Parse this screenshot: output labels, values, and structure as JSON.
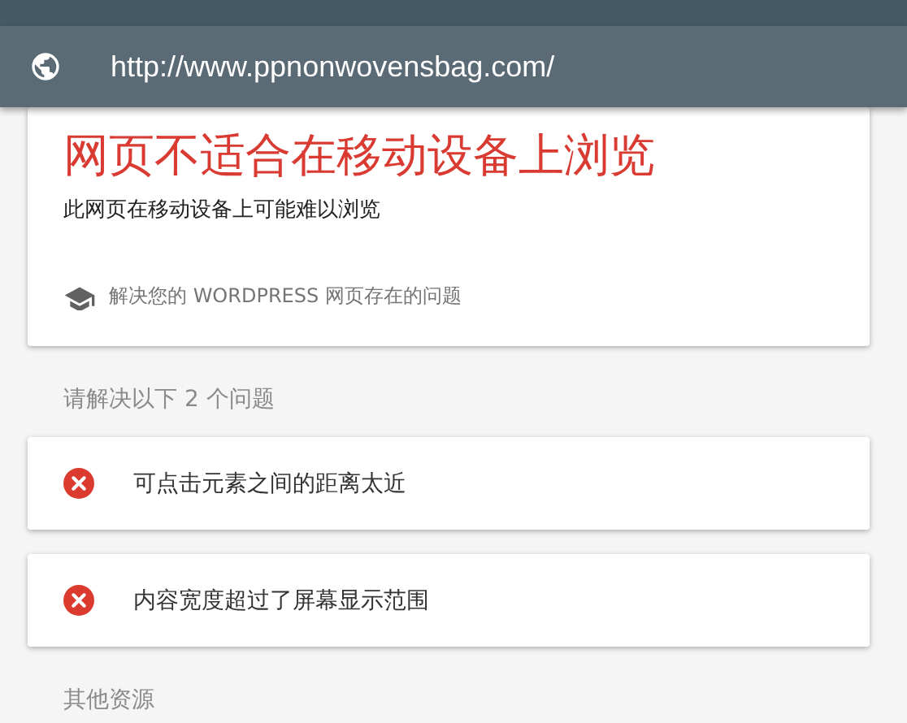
{
  "address_bar": {
    "url": "http://www.ppnonwovensbag.com/"
  },
  "result_card": {
    "title": "网页不适合在移动设备上浏览",
    "subtitle": "此网页在移动设备上可能难以浏览",
    "help_link": "解决您的 WORDPRESS 网页存在的问题"
  },
  "issues_heading": "请解决以下 2 个问题",
  "issues": [
    {
      "text": "可点击元素之间的距离太近"
    },
    {
      "text": "内容宽度超过了屏幕显示范围"
    }
  ],
  "resources_heading": "其他资源"
}
